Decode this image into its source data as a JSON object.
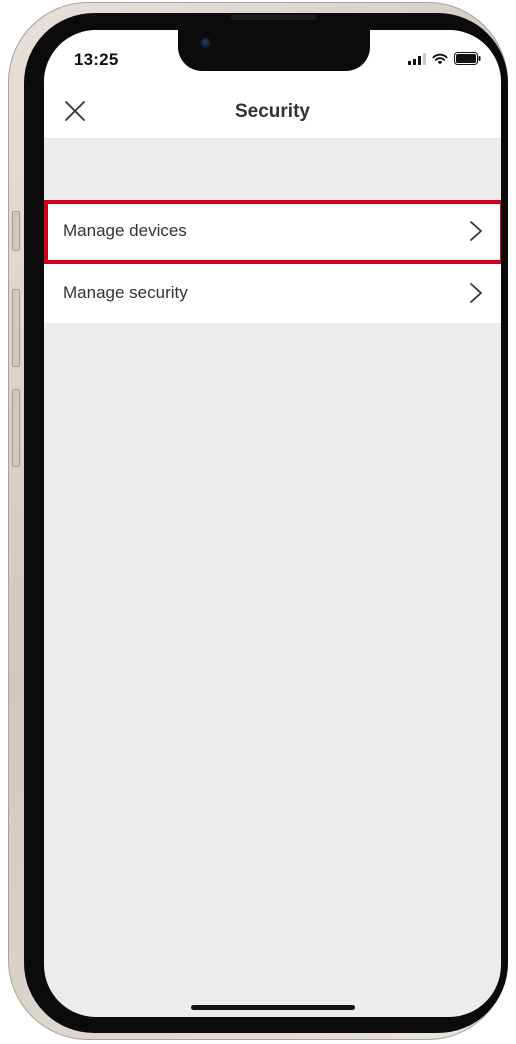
{
  "status_bar": {
    "time": "13:25",
    "icons": [
      "signal-icon",
      "wifi-icon",
      "battery-icon"
    ]
  },
  "header": {
    "title": "Security",
    "close_icon": "close-icon"
  },
  "menu": {
    "items": [
      {
        "label": "Manage devices",
        "icon": "chevron-right-icon",
        "highlighted": true
      },
      {
        "label": "Manage security",
        "icon": "chevron-right-icon",
        "highlighted": false
      }
    ]
  },
  "colors": {
    "screen_background": "#ececec",
    "highlight_border": "#d0021b",
    "text": "#333333"
  }
}
